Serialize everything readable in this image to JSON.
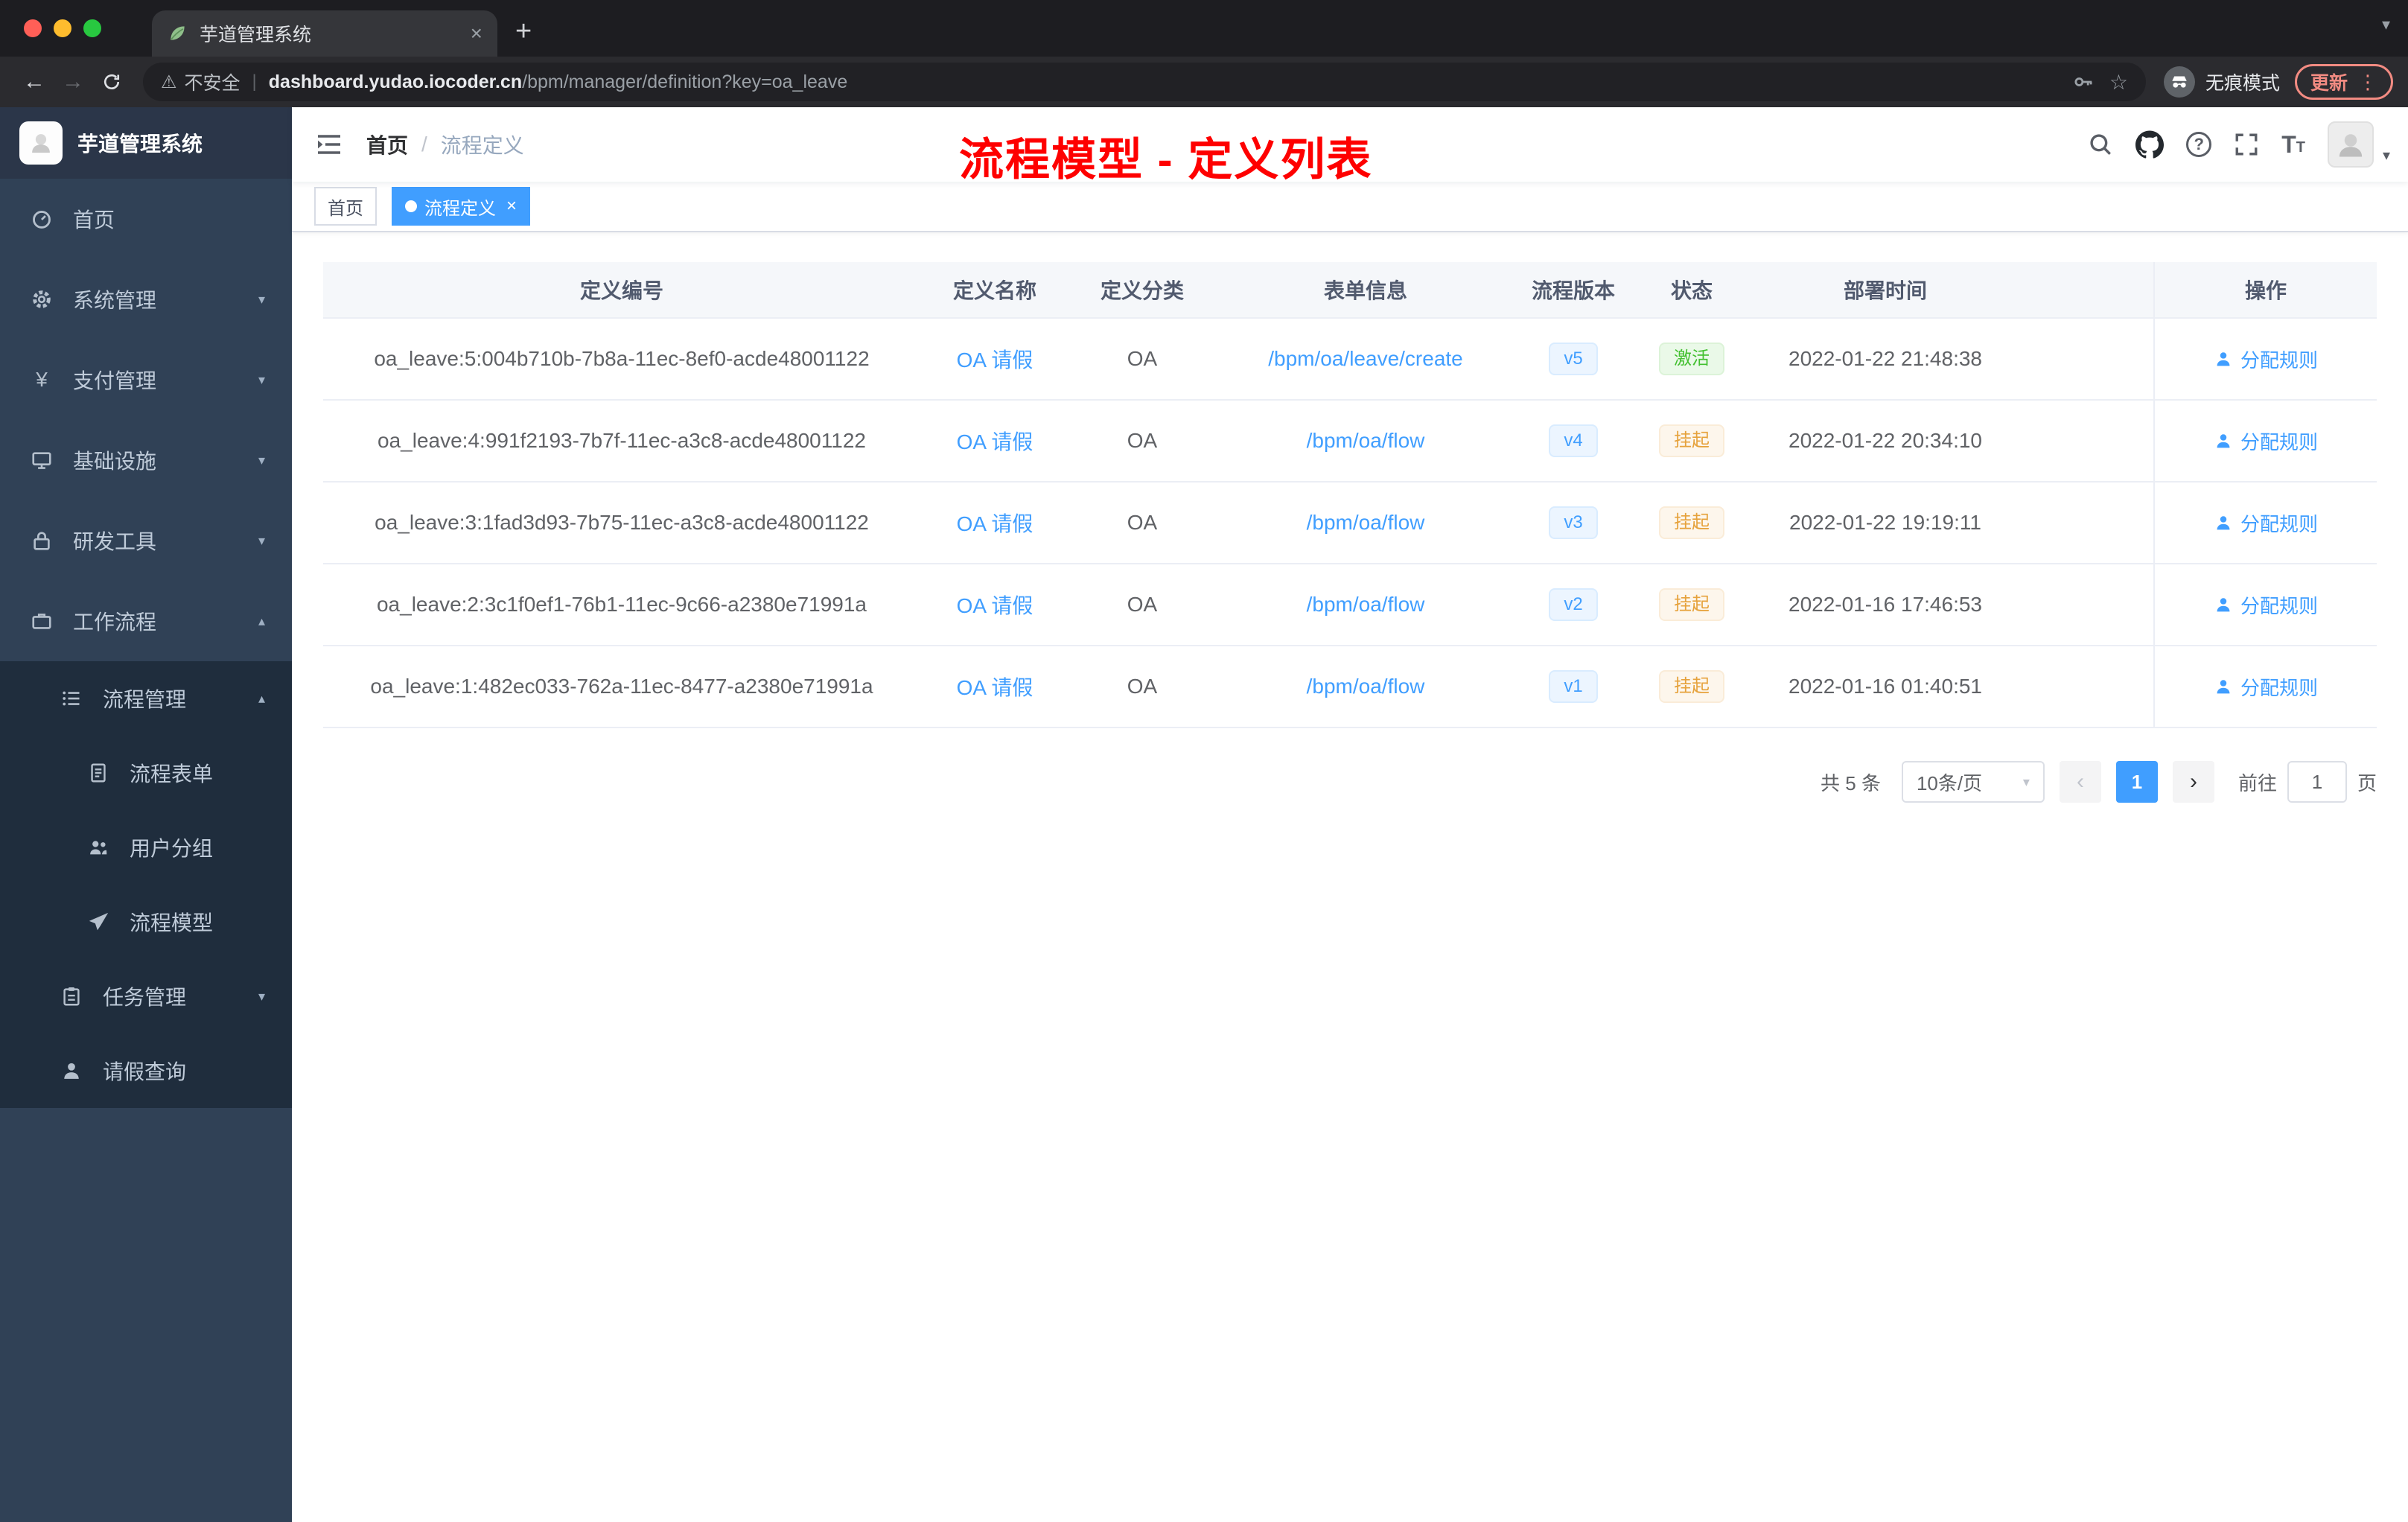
{
  "browser": {
    "tab": {
      "title": "芋道管理系统",
      "close_glyph": "×",
      "new_tab_glyph": "+"
    },
    "nav": {
      "back_glyph": "←",
      "forward_glyph": "→",
      "security_label": "不安全",
      "separator": "|",
      "url_host": "dashboard.yudao.iocoder.cn",
      "url_path": "/bpm/manager/definition?key=oa_leave",
      "star_glyph": "☆",
      "incognito_label": "无痕模式",
      "update_label": "更新",
      "menu_glyph": "⋮"
    }
  },
  "icons": {
    "chevron_down": "▾",
    "chevron_up": "▴",
    "warning_glyph": "⚠",
    "question_glyph": "?",
    "yen_glyph": "¥",
    "font_size_glyph": "T",
    "tab_search_glyph": "▾"
  },
  "sidebar": {
    "logo_title": "芋道管理系统",
    "menu": [
      {
        "label": "首页"
      },
      {
        "label": "系统管理"
      },
      {
        "label": "支付管理"
      },
      {
        "label": "基础设施"
      },
      {
        "label": "研发工具"
      },
      {
        "label": "工作流程"
      }
    ],
    "submenu": {
      "process_mgmt": "流程管理",
      "children": [
        "流程表单",
        "用户分组",
        "流程模型"
      ],
      "task_mgmt": "任务管理",
      "leave_query": "请假查询"
    }
  },
  "header": {
    "breadcrumb_home": "首页",
    "breadcrumb_sep": "/",
    "breadcrumb_current": "流程定义",
    "annotation": "流程模型 - 定义列表"
  },
  "tags_view": {
    "home": "首页",
    "active": "流程定义",
    "close_glyph": "×"
  },
  "table": {
    "columns": [
      "定义编号",
      "定义名称",
      "定义分类",
      "表单信息",
      "流程版本",
      "状态",
      "部署时间",
      "操作"
    ],
    "action_label": "分配规则",
    "rows": [
      {
        "id": "oa_leave:5:004b710b-7b8a-11ec-8ef0-acde48001122",
        "name": "OA 请假",
        "category": "OA",
        "form": "/bpm/oa/leave/create",
        "version": "v5",
        "status": "激活",
        "deploy_time": "2022-01-22 21:48:38"
      },
      {
        "id": "oa_leave:4:991f2193-7b7f-11ec-a3c8-acde48001122",
        "name": "OA 请假",
        "category": "OA",
        "form": "/bpm/oa/flow",
        "version": "v4",
        "status": "挂起",
        "deploy_time": "2022-01-22 20:34:10"
      },
      {
        "id": "oa_leave:3:1fad3d93-7b75-11ec-a3c8-acde48001122",
        "name": "OA 请假",
        "category": "OA",
        "form": "/bpm/oa/flow",
        "version": "v3",
        "status": "挂起",
        "deploy_time": "2022-01-22 19:19:11"
      },
      {
        "id": "oa_leave:2:3c1f0ef1-76b1-11ec-9c66-a2380e71991a",
        "name": "OA 请假",
        "category": "OA",
        "form": "/bpm/oa/flow",
        "version": "v2",
        "status": "挂起",
        "deploy_time": "2022-01-16 17:46:53"
      },
      {
        "id": "oa_leave:1:482ec033-762a-11ec-8477-a2380e71991a",
        "name": "OA 请假",
        "category": "OA",
        "form": "/bpm/oa/flow",
        "version": "v1",
        "status": "挂起",
        "deploy_time": "2022-01-16 01:40:51"
      }
    ]
  },
  "pagination": {
    "total_label": "共 5 条",
    "page_size": "10条/页",
    "prev_glyph": "‹",
    "next_glyph": "›",
    "current_page": "1",
    "goto_label": "前往",
    "goto_value": "1",
    "unit_label": "页"
  },
  "colors": {
    "accent": "#409eff",
    "annotation_red": "#fe0000",
    "success": "#43c030",
    "warning": "#e6a23c",
    "sidebar_bg": "#304156",
    "submenu_bg": "#1f2d3d"
  }
}
